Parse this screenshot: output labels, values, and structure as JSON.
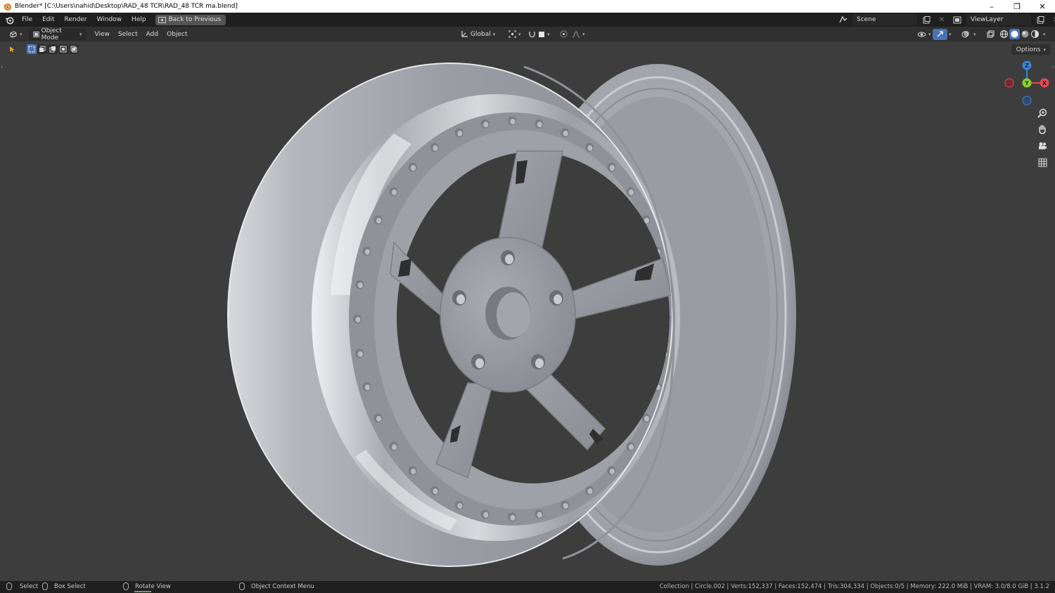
{
  "window": {
    "title": "Blender* [C:\\Users\\nahid\\Desktop\\RAD_48 TCR\\RAD_48 TCR ma.blend]",
    "minimize": "–",
    "restore": "❐",
    "close": "✕"
  },
  "topbar": {
    "menus": [
      "File",
      "Edit",
      "Render",
      "Window",
      "Help"
    ],
    "back_button": "Back to Previous",
    "scene": "Scene",
    "view_layer": "ViewLayer"
  },
  "viewport_header": {
    "mode": "Object Mode",
    "menus": [
      "View",
      "Select",
      "Add",
      "Object"
    ],
    "orientation": "Global"
  },
  "viewport": {
    "options": "Options",
    "gizmo": {
      "z": "Z",
      "y": "Y",
      "x": "X"
    }
  },
  "statusbar": {
    "select": "Select",
    "box_select": "Box Select",
    "rotate_view": "Rotate View",
    "context_menu": "Object Context Menu",
    "stats": "Collection | Circle.002 | Verts:152,337 | Faces:152,474 | Tris:304,334 | Objects:0/5 | Memory: 222.0 MiB | VRAM: 3.0/8.0 GiB | 3.1.2"
  },
  "colors": {
    "accent": "#4772b3",
    "axis_x": "#e34a55",
    "axis_y": "#8bd12c",
    "axis_z": "#3b83d6"
  }
}
